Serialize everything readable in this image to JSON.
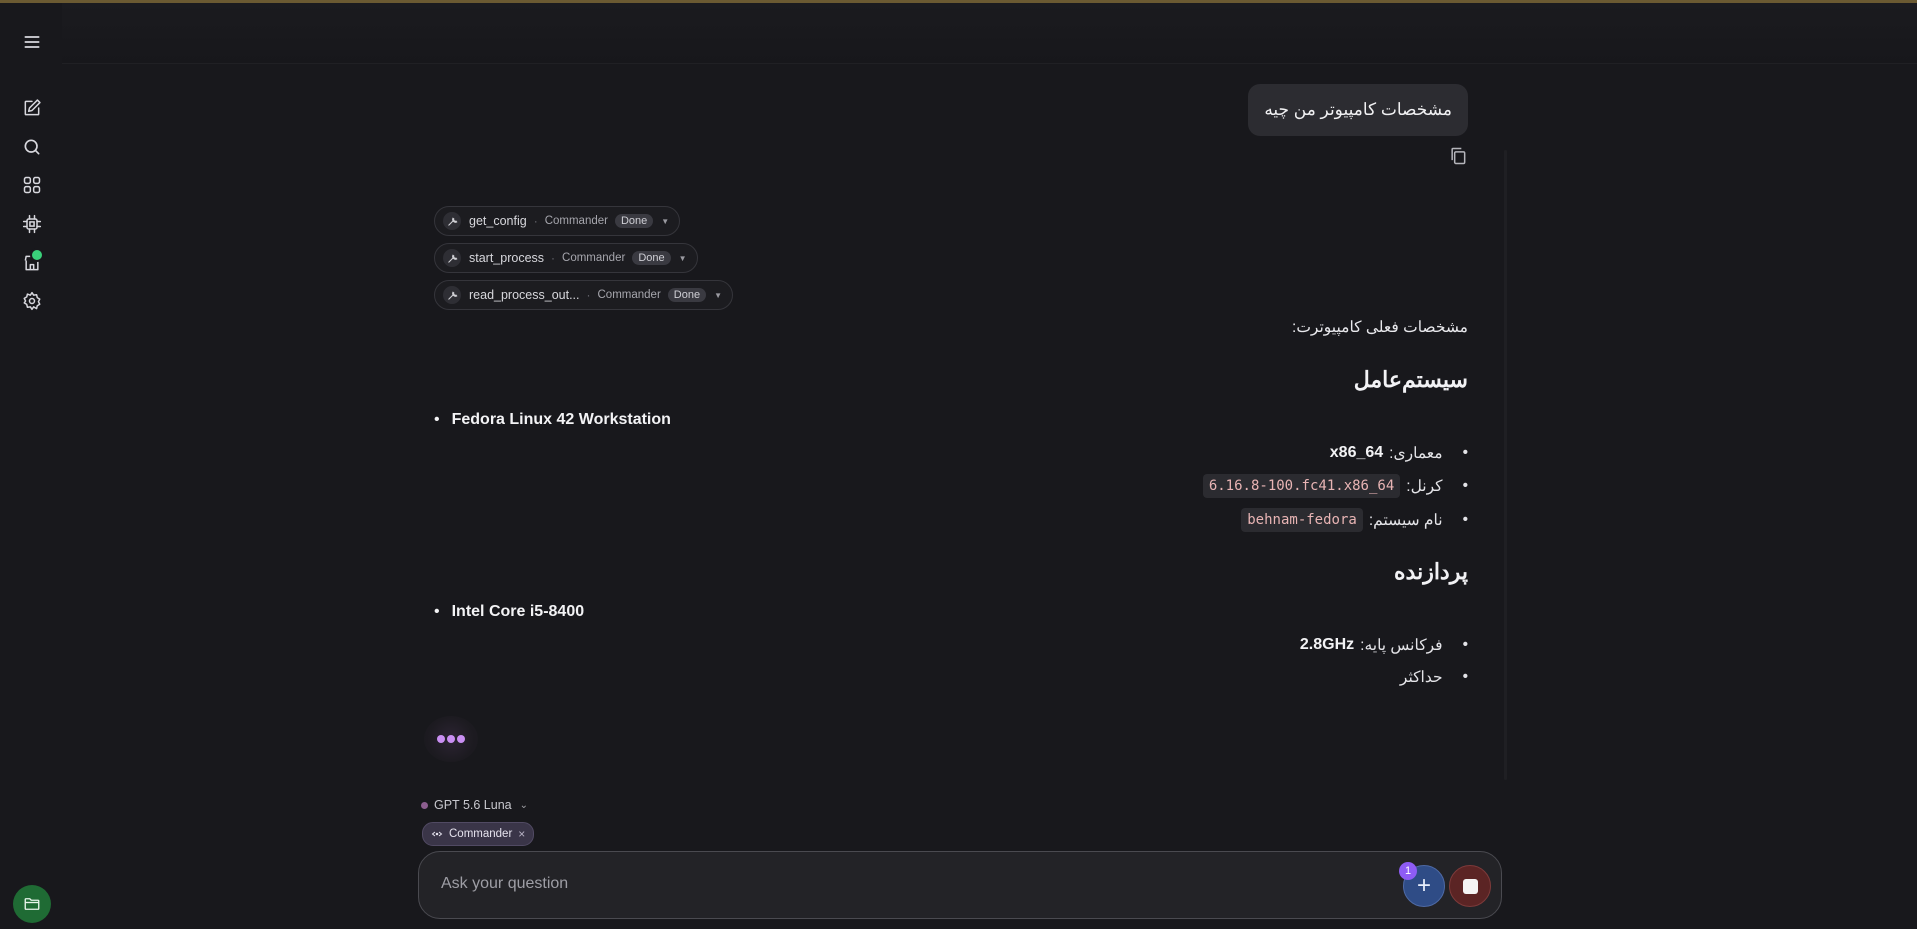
{
  "user_message": "مشخصات کامپیوتر من چیه",
  "tools": [
    {
      "name": "get_config",
      "source": "Commander",
      "status": "Done"
    },
    {
      "name": "start_process",
      "source": "Commander",
      "status": "Done"
    },
    {
      "name": "read_process_out...",
      "source": "Commander",
      "status": "Done"
    }
  ],
  "separator": "·",
  "response": {
    "intro": "مشخصات فعلی کامپیوترت:",
    "os_heading": "سیستم‌عامل",
    "os_name": "Fedora Linux 42 Workstation",
    "arch_label": "معماری:",
    "arch_value": "x86_64",
    "kernel_label": "کرنل:",
    "kernel_value": "6.16.8-100.fc41.x86_64",
    "hostname_label": "نام سیستم:",
    "hostname_value": "behnam-fedora",
    "cpu_heading": "پردازنده",
    "cpu_name": "Intel Core i5-8400",
    "base_freq_label": "فرکانس پایه:",
    "base_freq_value": "2.8GHz",
    "max_label": "حداکثر"
  },
  "bullet": "•",
  "model": {
    "name": "GPT 5.6 Luna",
    "chevron": "⌄"
  },
  "chip": {
    "label": "Commander",
    "close": "×"
  },
  "input": {
    "placeholder": "Ask your question"
  },
  "attach_count": "1",
  "add_glyph": "+"
}
